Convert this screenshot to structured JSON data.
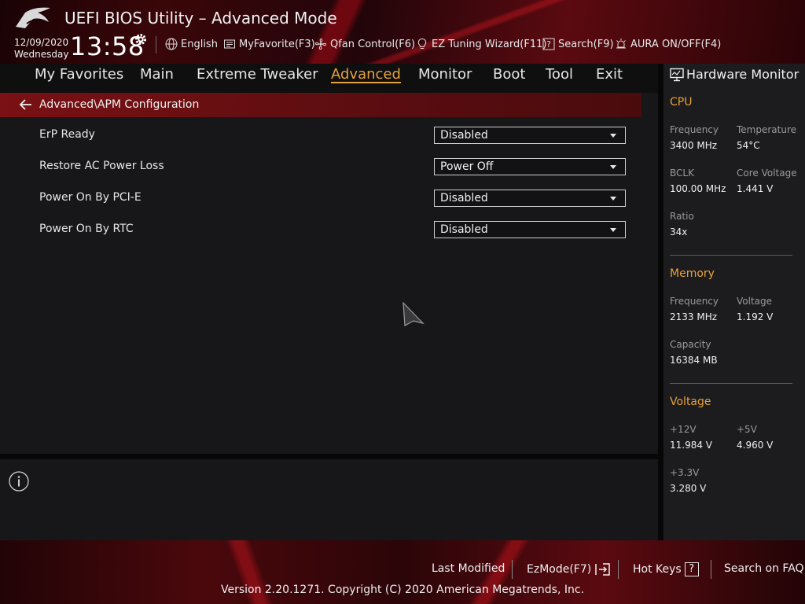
{
  "header": {
    "title": "UEFI BIOS Utility – Advanced Mode",
    "date": "12/09/2020",
    "weekday": "Wednesday",
    "time": "13:58",
    "items": [
      {
        "label": "English",
        "icon": "globe-icon"
      },
      {
        "label": "MyFavorite(F3)",
        "icon": "favorite-icon"
      },
      {
        "label": "Qfan Control(F6)",
        "icon": "fan-icon"
      },
      {
        "label": "EZ Tuning Wizard(F11)",
        "icon": "lightbulb-icon"
      },
      {
        "label": "Search(F9)",
        "icon": "search-help-icon"
      },
      {
        "label": "AURA ON/OFF(F4)",
        "icon": "aura-icon"
      }
    ]
  },
  "tabs": [
    {
      "label": "My Favorites",
      "active": false
    },
    {
      "label": "Main",
      "active": false
    },
    {
      "label": "Extreme Tweaker",
      "active": false
    },
    {
      "label": "Advanced",
      "active": true
    },
    {
      "label": "Monitor",
      "active": false
    },
    {
      "label": "Boot",
      "active": false
    },
    {
      "label": "Tool",
      "active": false
    },
    {
      "label": "Exit",
      "active": false
    }
  ],
  "breadcrumb": "Advanced\\APM Configuration",
  "settings": [
    {
      "label": "ErP Ready",
      "value": "Disabled"
    },
    {
      "label": "Restore AC Power Loss",
      "value": "Power Off"
    },
    {
      "label": "Power On By PCI-E",
      "value": "Disabled"
    },
    {
      "label": "Power On By RTC",
      "value": "Disabled"
    }
  ],
  "hw_monitor": {
    "title": "Hardware Monitor",
    "cpu": {
      "heading": "CPU",
      "frequency_label": "Frequency",
      "frequency": "3400 MHz",
      "temperature_label": "Temperature",
      "temperature": "54°C",
      "bclk_label": "BCLK",
      "bclk": "100.00 MHz",
      "core_voltage_label": "Core Voltage",
      "core_voltage": "1.441 V",
      "ratio_label": "Ratio",
      "ratio": "34x"
    },
    "memory": {
      "heading": "Memory",
      "frequency_label": "Frequency",
      "frequency": "2133 MHz",
      "voltage_label": "Voltage",
      "voltage": "1.192 V",
      "capacity_label": "Capacity",
      "capacity": "16384 MB"
    },
    "voltage": {
      "heading": "Voltage",
      "v12_label": "+12V",
      "v12": "11.984 V",
      "v5_label": "+5V",
      "v5": "4.960 V",
      "v33_label": "+3.3V",
      "v33": "3.280 V"
    }
  },
  "footer": {
    "last_modified": "Last Modified",
    "ezmode": "EzMode(F7)",
    "hotkeys": "Hot Keys",
    "hotkeys_icon": "?",
    "search_faq": "Search on FAQ",
    "version": "Version 2.20.1271. Copyright (C) 2020 American Megatrends, Inc."
  },
  "colors": {
    "accent": "#e8a13a",
    "breadcrumb_bg": "#7a1114",
    "panel_bg": "#171719"
  }
}
